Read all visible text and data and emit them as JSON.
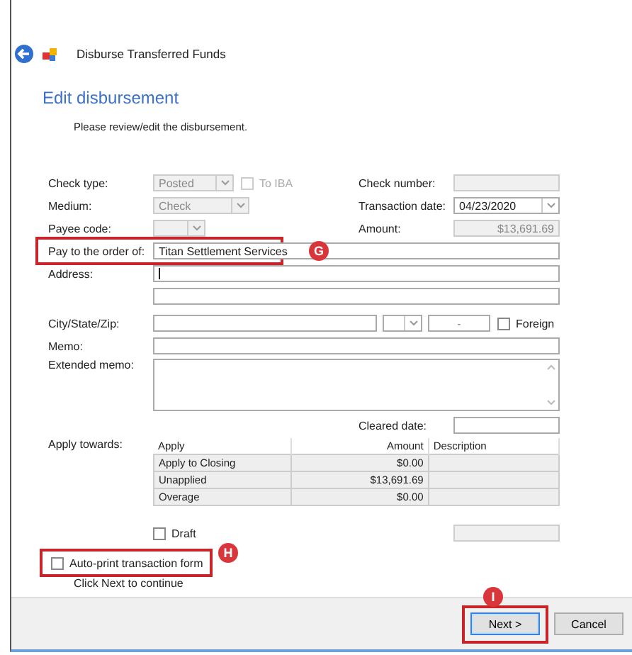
{
  "window": {
    "title": "Disburse Transferred Funds"
  },
  "heading": "Edit disbursement",
  "instruction": "Please review/edit the disbursement.",
  "check_type": {
    "label": "Check type:",
    "value": "Posted",
    "disabled": true
  },
  "to_iba": {
    "label": "To IBA",
    "checked": false,
    "disabled": true
  },
  "check_number": {
    "label": "Check number:",
    "disabled": true
  },
  "medium": {
    "label": "Medium:",
    "value": "Check",
    "disabled": true
  },
  "transaction_date": {
    "label": "Transaction date:",
    "value": "04/23/2020",
    "disabled": false
  },
  "payee_code": {
    "label": "Payee code:",
    "disabled": true
  },
  "amount": {
    "label": "Amount:",
    "value": "$13,691.69",
    "disabled": true
  },
  "pay_to": {
    "label": "Pay to the order of:",
    "value": "Titan Settlement Services"
  },
  "address": {
    "label": "Address:"
  },
  "city_state_zip": {
    "label": "City/State/Zip:",
    "zip": "-"
  },
  "foreign": {
    "label": "Foreign",
    "checked": false
  },
  "memo": {
    "label": "Memo:"
  },
  "extended_memo": {
    "label": "Extended memo:"
  },
  "cleared_date": {
    "label": "Cleared date:"
  },
  "apply_towards": {
    "label": "Apply towards:",
    "columns": [
      "Apply",
      "Amount",
      "Description"
    ],
    "rows": [
      {
        "apply": "Apply to Closing",
        "amount": "$0.00"
      },
      {
        "apply": "Unapplied",
        "amount": "$13,691.69"
      },
      {
        "apply": "Overage",
        "amount": "$0.00"
      }
    ]
  },
  "draft": {
    "label": "Draft",
    "checked": false
  },
  "draft_field": {
    "disabled": true
  },
  "auto_print": {
    "label": "Auto-print transaction form",
    "checked": false
  },
  "hint": "Click Next to continue",
  "buttons": [
    {
      "label": "Next >",
      "focused": true
    },
    {
      "label": "Cancel",
      "focused": false
    }
  ],
  "callouts": [
    {
      "letter": "G"
    },
    {
      "letter": "H"
    },
    {
      "letter": "I"
    }
  ]
}
